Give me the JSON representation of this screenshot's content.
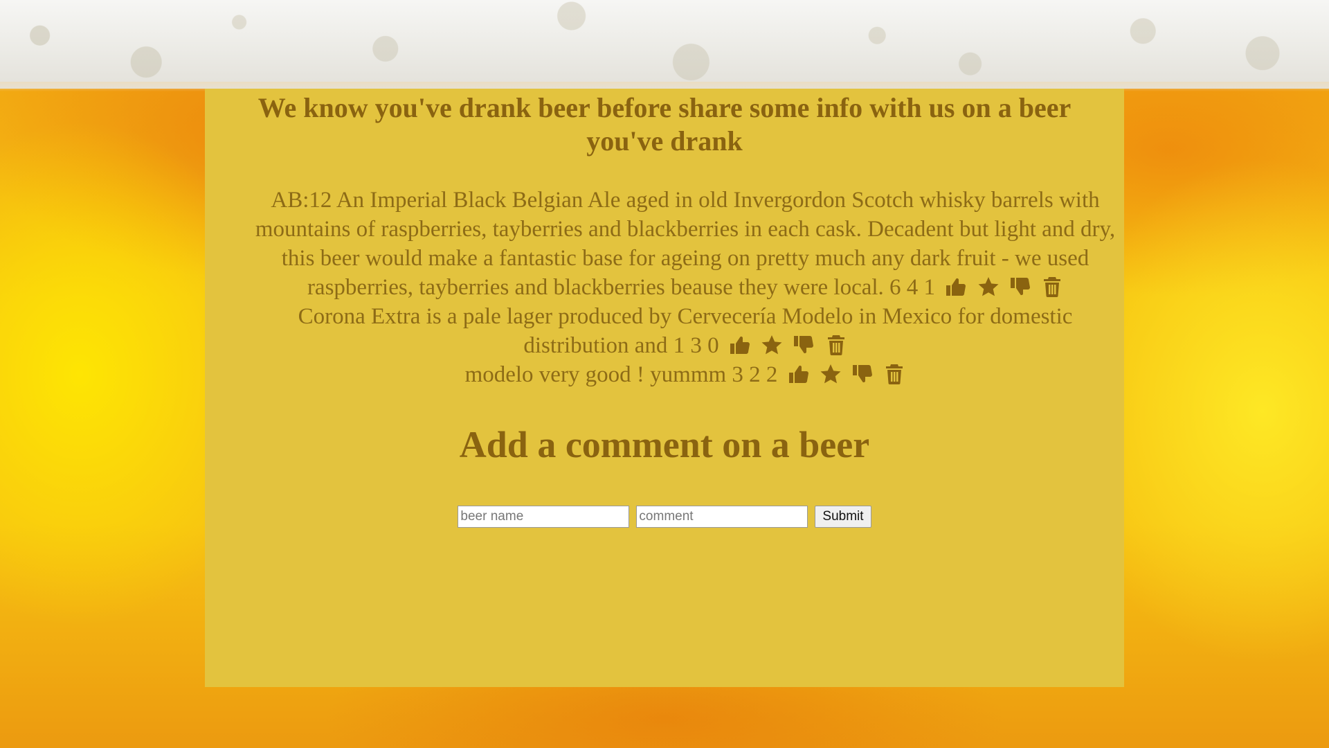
{
  "page": {
    "title": "We know you've drank beer before share some info with us on a beer you've drank"
  },
  "beers": [
    {
      "text": "AB:12 An Imperial Black Belgian Ale aged in old Invergordon Scotch whisky barrels with mountains of raspberries, tayberries and blackberries in each cask. Decadent but light and dry, this beer would make a fantastic base for ageing on pretty much any dark fruit - we used raspberries, tayberries and blackberries beause they were local. 6 4 1"
    },
    {
      "text": "Corona Extra is a pale lager produced by Cervecería Modelo in Mexico for domestic distribution and 1 3 0"
    },
    {
      "text": "modelo very good ! yummm 3 2 2"
    }
  ],
  "comment_section": {
    "heading": "Add a comment on a beer",
    "beer_name_placeholder": "beer name",
    "comment_placeholder": "comment",
    "submit_label": "Submit"
  },
  "icons": {
    "like": "thumbs-up-icon",
    "favorite": "star-icon",
    "dislike": "thumbs-down-icon",
    "delete": "trash-icon"
  },
  "colors": {
    "panel_background": "#e3c33e",
    "text": "#8a6512",
    "foam": "#ecebe6",
    "beer": "#f7c512"
  }
}
